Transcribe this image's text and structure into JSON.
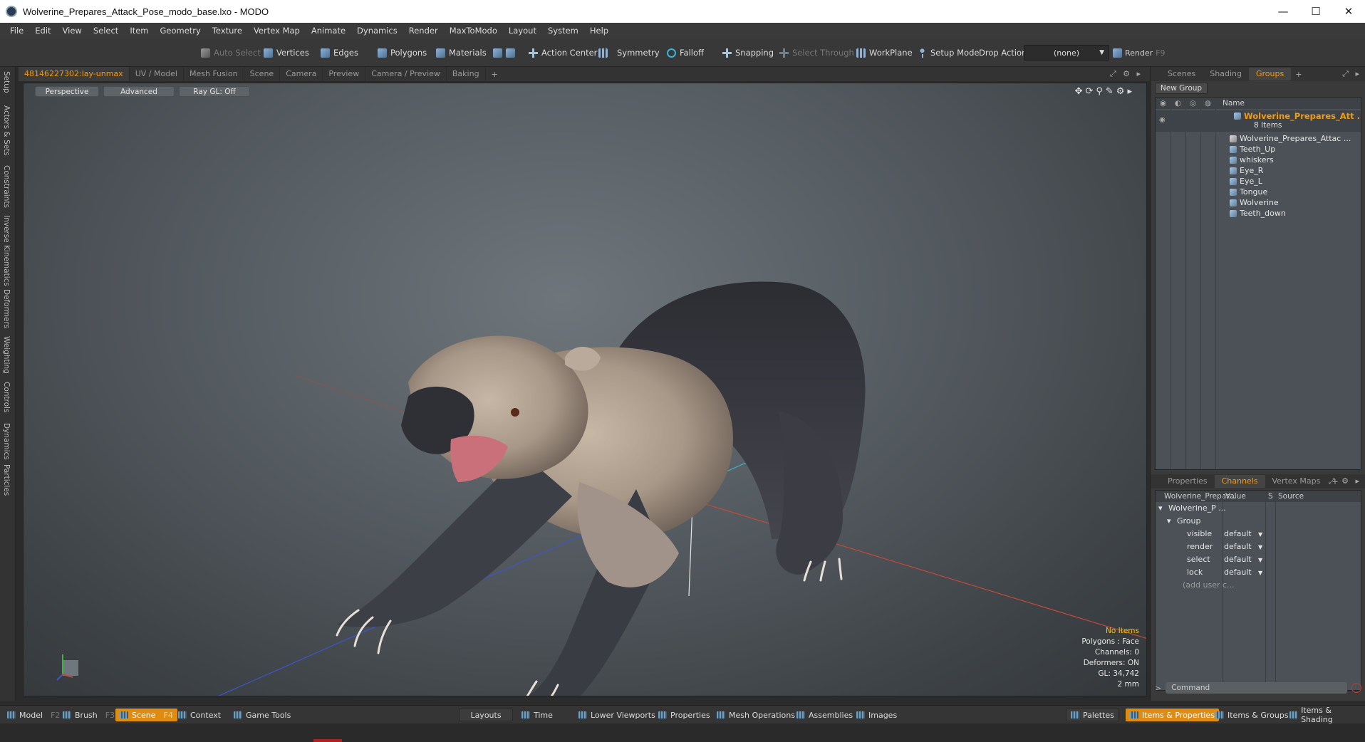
{
  "window": {
    "title": "Wolverine_Prepares_Attack_Pose_modo_base.lxo - MODO",
    "minimize": "—",
    "maximize": "☐",
    "close": "✕"
  },
  "menu": [
    "File",
    "Edit",
    "View",
    "Select",
    "Item",
    "Geometry",
    "Texture",
    "Vertex Map",
    "Animate",
    "Dynamics",
    "Render",
    "MaxToModo",
    "Layout",
    "System",
    "Help"
  ],
  "toolbar": {
    "auto_select": "Auto Select",
    "vertices": "Vertices",
    "edges": "Edges",
    "polygons": "Polygons",
    "materials": "Materials",
    "action_center": "Action Center",
    "symmetry": "Symmetry",
    "falloff": "Falloff",
    "snapping": "Snapping",
    "select_through": "Select Through",
    "workplane": "WorkPlane",
    "setup_mode": "Setup Mode",
    "drop_action_label": "Drop Action",
    "drop_action_value": "(none)",
    "render": "Render",
    "render_key": "F9"
  },
  "left_tabs": [
    "Setup",
    "Actors & Sets",
    "Constraints",
    "Inverse Kinematics",
    "Deformers",
    "Weighting",
    "Controls",
    "Dynamics",
    "Particles"
  ],
  "viewport_tabs": [
    "48146227302:lay-unmax",
    "UV / Model",
    "Mesh Fusion",
    "Scene",
    "Camera",
    "Preview",
    "Camera / Preview",
    "Baking"
  ],
  "viewport": {
    "perspective": "Perspective",
    "advanced": "Advanced",
    "raygl": "Ray GL: Off",
    "hud": {
      "items": "No Items",
      "polygons": "Polygons : Face",
      "channels": "Channels: 0",
      "deformers": "Deformers: ON",
      "gl": "GL: 34,742",
      "unit": "2 mm"
    }
  },
  "right_tabs": [
    "Scenes",
    "Shading",
    "Groups"
  ],
  "groups": {
    "new_group": "New Group",
    "name_header": "Name",
    "group_name": "Wolverine_Prepares_Att ...",
    "item_count": "8 Items",
    "items": [
      "Wolverine_Prepares_Attac ...",
      "Teeth_Up",
      "whiskers",
      "Eye_R",
      "Eye_L",
      "Tongue",
      "Wolverine",
      "Teeth_down"
    ]
  },
  "channels_tabs": [
    "Properties",
    "Channels",
    "Vertex Maps"
  ],
  "channels": {
    "col_item": "Wolverine_Prepar...",
    "col_value": "Value",
    "col_s": "S",
    "col_source": "Source",
    "root": "Wolverine_P ...",
    "group": "Group",
    "rows": [
      {
        "name": "visible",
        "value": "default"
      },
      {
        "name": "render",
        "value": "default"
      },
      {
        "name": "select",
        "value": "default"
      },
      {
        "name": "lock",
        "value": "default"
      }
    ],
    "add_user": "(add user c..."
  },
  "command": {
    "placeholder": "Command"
  },
  "bottom": {
    "model": "Model",
    "model_key": "F2",
    "brush": "Brush",
    "brush_key": "F3",
    "scene": "Scene",
    "scene_key": "F4",
    "context": "Context",
    "game_tools": "Game Tools",
    "layouts": "Layouts",
    "time": "Time",
    "lower_viewports": "Lower Viewports",
    "properties": "Properties",
    "mesh_operations": "Mesh Operations",
    "assemblies": "Assemblies",
    "images": "Images",
    "palettes": "Palettes",
    "items_properties": "Items & Properties",
    "items_groups": "Items & Groups",
    "items_shading": "Items & Shading"
  }
}
